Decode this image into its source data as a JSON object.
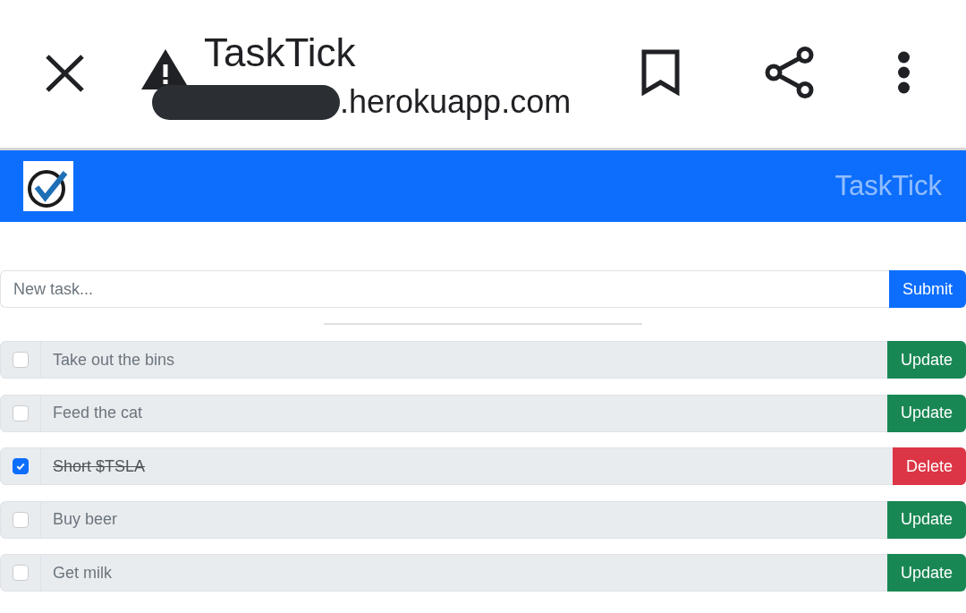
{
  "browser_bar": {
    "title": "TaskTick",
    "url": ".herokuapp.com",
    "url_redacted": true
  },
  "navbar": {
    "brand": "TaskTick"
  },
  "new_task": {
    "placeholder": "New task...",
    "button": "Submit"
  },
  "tasks": [
    {
      "text": "Take out the bins",
      "checked": false,
      "action": {
        "kind": "update",
        "label": "Update"
      }
    },
    {
      "text": "Feed the cat",
      "checked": false,
      "action": {
        "kind": "update",
        "label": "Update"
      }
    },
    {
      "text": "Short $TSLA",
      "checked": true,
      "action": {
        "kind": "delete",
        "label": "Delete"
      }
    },
    {
      "text": "Buy beer",
      "checked": false,
      "action": {
        "kind": "update",
        "label": "Update"
      }
    },
    {
      "text": "Get milk",
      "checked": false,
      "action": {
        "kind": "update",
        "label": "Update"
      }
    }
  ]
}
